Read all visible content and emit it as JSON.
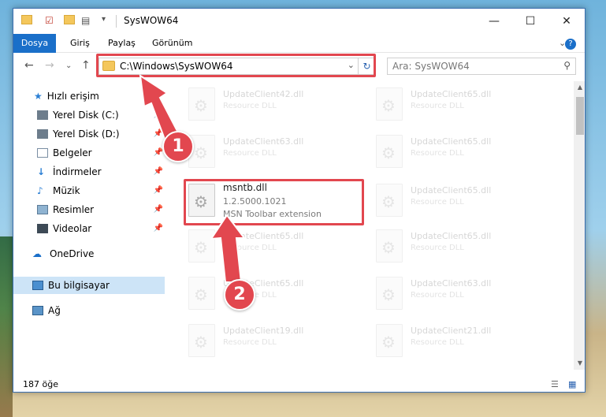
{
  "window": {
    "title": "SysWOW64"
  },
  "ribbon": {
    "tabs": [
      "Dosya",
      "Giriş",
      "Paylaş",
      "Görünüm"
    ]
  },
  "address": {
    "path": "C:\\Windows\\SysWOW64"
  },
  "search": {
    "placeholder": "Ara: SysWOW64"
  },
  "sidebar": {
    "quick_access": "Hızlı erişim",
    "items": [
      "Yerel Disk (C:)",
      "Yerel Disk (D:)",
      "Belgeler",
      "İndirmeler",
      "Müzik",
      "Resimler",
      "Videolar"
    ],
    "onedrive": "OneDrive",
    "this_pc": "Bu bilgisayar",
    "network": "Ağ"
  },
  "files": {
    "left": [
      {
        "name": "UpdateClient42.dll",
        "desc": "Resource DLL"
      },
      {
        "name": "UpdateClient63.dll",
        "desc": "Resource DLL"
      },
      {
        "name": "UpdateClient65.dll",
        "desc": "Resource DLL"
      },
      {
        "name": "UpdateClient65.dll",
        "desc": "Resource DLL"
      },
      {
        "name": "UpdateClient19.dll",
        "desc": "Resource DLL"
      }
    ],
    "right": [
      {
        "name": "UpdateClient65.dll",
        "desc": "Resource DLL"
      },
      {
        "name": "UpdateClient65.dll",
        "desc": "Resource DLL"
      },
      {
        "name": "UpdateClient65.dll",
        "desc": "Resource DLL"
      },
      {
        "name": "UpdateClient65.dll",
        "desc": "Resource DLL"
      },
      {
        "name": "UpdateClient63.dll",
        "desc": "Resource DLL"
      },
      {
        "name": "UpdateClient21.dll",
        "desc": "Resource DLL"
      }
    ],
    "highlighted": {
      "name": "msntb.dll",
      "version": "1.2.5000.1021",
      "desc": "MSN Toolbar extension"
    }
  },
  "status": {
    "count": "187 öğe"
  },
  "annotations": {
    "step1": "1",
    "step2": "2",
    "color": "#e2474f"
  }
}
